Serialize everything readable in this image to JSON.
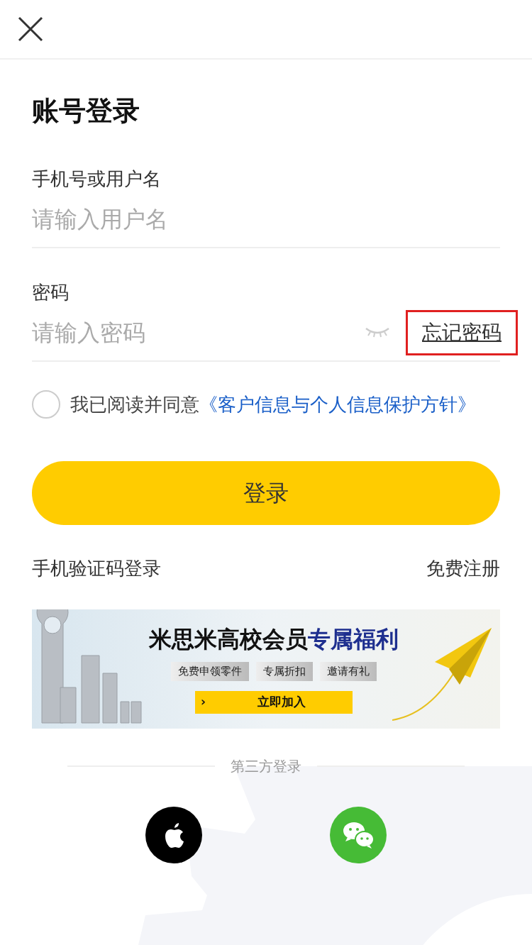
{
  "title": "账号登录",
  "fields": [
    {
      "label": "手机号或用户名",
      "placeholder": "请输入用户名",
      "kind": "text"
    },
    {
      "label": "密码",
      "placeholder": "请输入密码",
      "kind": "password",
      "password_visible": false,
      "forgot": {
        "text": "忘记密码",
        "highlighted": true
      }
    }
  ],
  "agreement": {
    "checked": false,
    "text": "我已阅读并同意",
    "link": "《客户信息与个人信息保护方针》"
  },
  "login_button": "登录",
  "links": [
    "手机验证码登录",
    "免费注册"
  ],
  "banner": {
    "title": "米思米高校会员",
    "title_highlight": "专属福利",
    "chips": [
      "免费申领零件",
      "专属折扣",
      "邀请有礼"
    ],
    "cta_arrow": "›",
    "cta": "立即加入"
  },
  "third_party": {
    "label": "第三方登录",
    "providers": [
      {
        "kind": "apple"
      },
      {
        "kind": "wechat"
      }
    ]
  }
}
